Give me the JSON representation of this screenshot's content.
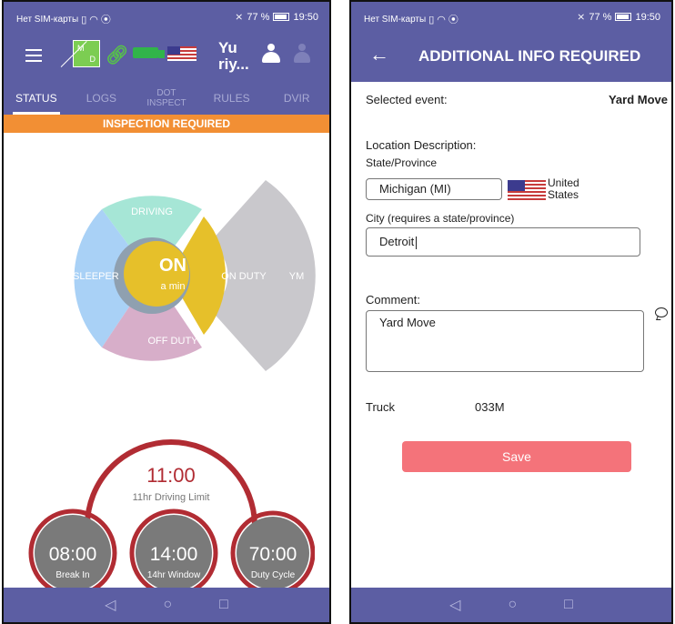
{
  "left": {
    "status_bar": {
      "carrier": "Нет SIM-карты",
      "battery": "77 %",
      "time": "19:50"
    },
    "app_bar": {
      "logo_top": "M",
      "logo_bottom": "D",
      "driver_name_line1": "Yu",
      "driver_name_line2": "riy..."
    },
    "tabs": [
      {
        "label": "STATUS",
        "active": true
      },
      {
        "label": "LOGS",
        "active": false
      },
      {
        "label_line1": "DOT",
        "label_line2": "INSPECT",
        "active": false
      },
      {
        "label": "RULES",
        "active": false
      },
      {
        "label": "DVIR",
        "active": false
      }
    ],
    "banner": "INSPECTION REQUIRED",
    "duty_wheel": {
      "driving": "DRIVING",
      "sleeper": "SLEEPER",
      "on_duty": "ON DUTY",
      "off_duty": "OFF DUTY",
      "ym": "YM",
      "center_status": "ON",
      "center_duration": "a min"
    },
    "gauges": {
      "main_value": "11:00",
      "main_label": "11hr Driving Limit",
      "items": [
        {
          "value": "08:00",
          "label": "Break In"
        },
        {
          "value": "14:00",
          "label": "14hr Window"
        },
        {
          "value": "70:00",
          "label": "Duty Cycle"
        }
      ]
    },
    "colors": {
      "primary": "#5c5ea3",
      "banner": "#f28f34",
      "driving": "#a6e6d6",
      "sleeper": "#a9d1f6",
      "on_duty": "#e6c02a",
      "off_duty": "#d7aec9",
      "ym": "#c9c8cc",
      "gauge_ring": "#b12c33",
      "gauge_fill": "#7a7a7a"
    }
  },
  "right": {
    "status_bar": {
      "carrier": "Нет SIM-карты",
      "battery": "77 %",
      "time": "19:50"
    },
    "title": "ADDITIONAL INFO REQUIRED",
    "selected_event_label": "Selected event:",
    "selected_event_value": "Yard Move",
    "location_description_label": "Location Description:",
    "state_province_label": "State/Province",
    "state_value": "Michigan (MI)",
    "country_line1": "United",
    "country_line2": "States",
    "city_label": "City (requires a state/province)",
    "city_value": "Detroit",
    "comment_label": "Comment:",
    "comment_value": "Yard Move",
    "truck_label": "Truck",
    "truck_value": "033M",
    "save_label": "Save",
    "colors": {
      "save": "#f4737a"
    }
  },
  "icons": {
    "menu": "hamburger-icon",
    "back": "arrow-left-icon",
    "nav_back": "triangle-back-icon",
    "nav_home": "circle-home-icon",
    "nav_recent": "square-recent-icon"
  }
}
